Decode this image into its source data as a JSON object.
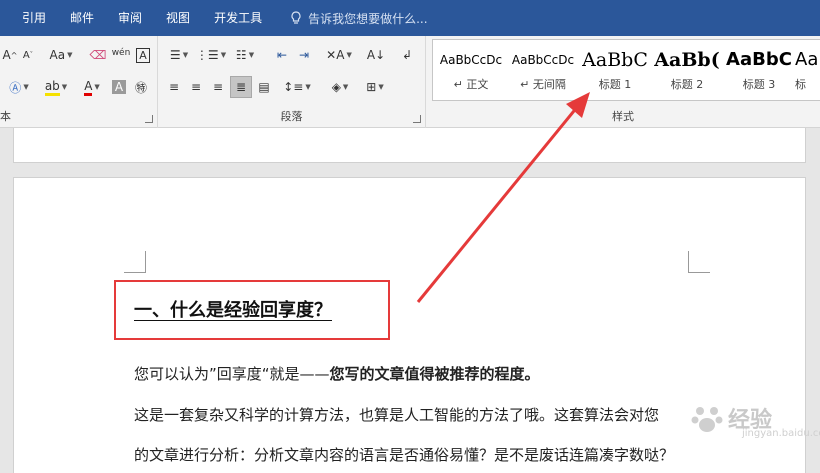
{
  "menubar": {
    "tabs": [
      "引用",
      "邮件",
      "审阅",
      "视图",
      "开发工具"
    ],
    "tell_me": "告诉我您想要做什么..."
  },
  "ribbon": {
    "font_group_label": "本",
    "font_size_label": "Aa",
    "paragraph_label": "段落",
    "styles_label": "样式",
    "styles": [
      {
        "preview": "AaBbCcDc",
        "name": "正文"
      },
      {
        "preview": "AaBbCcDc",
        "name": "无间隔"
      },
      {
        "preview": "AaBbC",
        "name": "标题 1"
      },
      {
        "preview": "AaBb(",
        "name": "标题 2"
      },
      {
        "preview": "AaBbC",
        "name": "标题 3"
      },
      {
        "preview": "Aa",
        "name": "标"
      }
    ]
  },
  "document": {
    "heading": "一、什么是经验回享度？",
    "para1_normal": "您可以认为”回享度“就是——",
    "para1_bold": "您写的文章值得被推荐的程度。",
    "para2": "这是一套复杂又科学的计算方法，也算是人工智能的方法了哦。这套算法会对您",
    "para3": "的文章进行分析：分析文章内容的语言是否通俗易懂？是不是废话连篇凑字数哒？"
  },
  "watermark": {
    "text": "经验",
    "sub": "jingyan.baidu.com"
  },
  "colors": {
    "titlebar": "#2b579a",
    "annotation": "#e53a3a"
  }
}
